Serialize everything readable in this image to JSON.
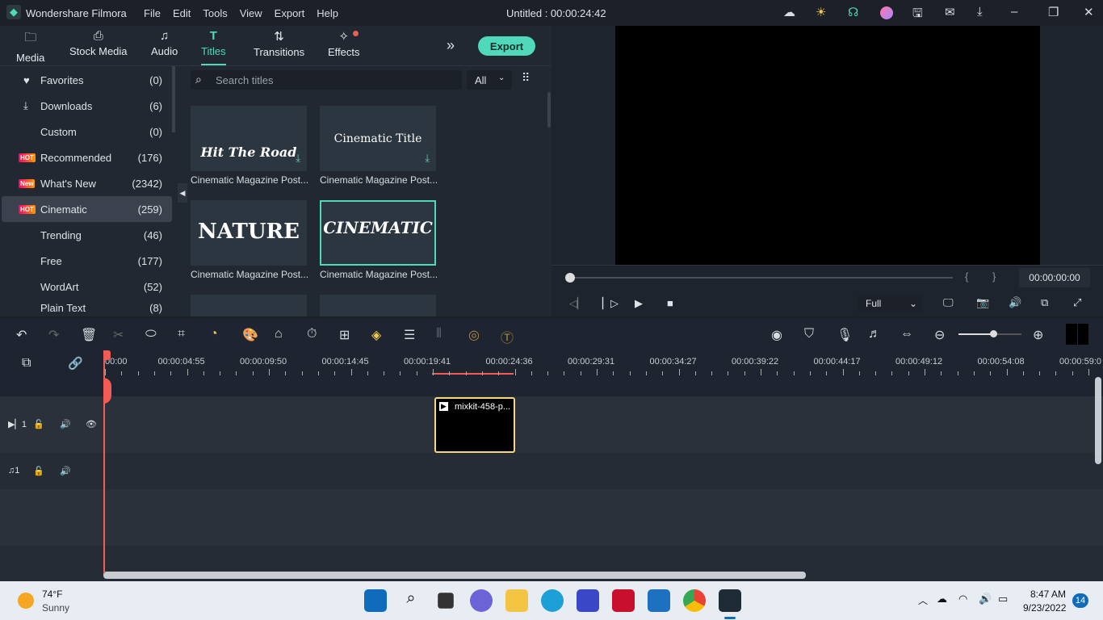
{
  "app": {
    "name": "Wondershare Filmora",
    "title": "Untitled : 00:00:24:42",
    "menu": [
      "File",
      "Edit",
      "Tools",
      "View",
      "Export",
      "Help"
    ]
  },
  "tabs": [
    {
      "label": "Media",
      "icon": "folder-icon"
    },
    {
      "label": "Stock Media",
      "icon": "stock-icon"
    },
    {
      "label": "Audio",
      "icon": "music-icon"
    },
    {
      "label": "Titles",
      "icon": "text-icon",
      "active": true
    },
    {
      "label": "Transitions",
      "icon": "transition-icon"
    },
    {
      "label": "Effects",
      "icon": "effects-icon"
    }
  ],
  "export_label": "Export",
  "search": {
    "placeholder": "Search titles",
    "filter": "All"
  },
  "sidebar": [
    {
      "label": "Favorites",
      "count": "(0)"
    },
    {
      "label": "Downloads",
      "count": "(6)"
    },
    {
      "label": "Custom",
      "count": "(0)"
    },
    {
      "label": "Recommended",
      "count": "(176)",
      "badge": "HOT"
    },
    {
      "label": "What's New",
      "count": "(2342)",
      "badge": "New"
    },
    {
      "label": "Cinematic",
      "count": "(259)",
      "badge": "HOT",
      "selected": true
    },
    {
      "label": "Trending",
      "count": "(46)"
    },
    {
      "label": "Free",
      "count": "(177)"
    },
    {
      "label": "WordArt",
      "count": "(52)"
    },
    {
      "label": "Plain Text",
      "count": "(8)"
    }
  ],
  "titles": [
    {
      "thumb": "Hit The Road",
      "caption": "Cinematic Magazine Post..."
    },
    {
      "thumb": "Cinematic Title",
      "caption": "Cinematic Magazine Post..."
    },
    {
      "thumb": "NATURE",
      "caption": "Cinematic Magazine Post..."
    },
    {
      "thumb": "CINEMATIC",
      "caption": "Cinematic Magazine Post..."
    }
  ],
  "player": {
    "timecode": "00:00:00:00",
    "quality": "Full",
    "progress": 0
  },
  "ruler": [
    "00:00",
    "00:00:04:55",
    "00:00:09:50",
    "00:00:14:45",
    "00:00:19:41",
    "00:00:24:36",
    "00:00:29:31",
    "00:00:34:27",
    "00:00:39:22",
    "00:00:44:17",
    "00:00:49:12",
    "00:00:54:08",
    "00:00:59:0"
  ],
  "clip": {
    "name": "mixkit-458-p..."
  },
  "tracks": {
    "video": "1",
    "audio": "1"
  },
  "taskbar": {
    "temp": "74°F",
    "weather": "Sunny",
    "time": "8:47 AM",
    "date": "9/23/2022",
    "notifications": "14"
  },
  "colors": {
    "accent": "#4fd8b9",
    "playhead": "#f25c54",
    "clip_border": "#f6d77c"
  }
}
